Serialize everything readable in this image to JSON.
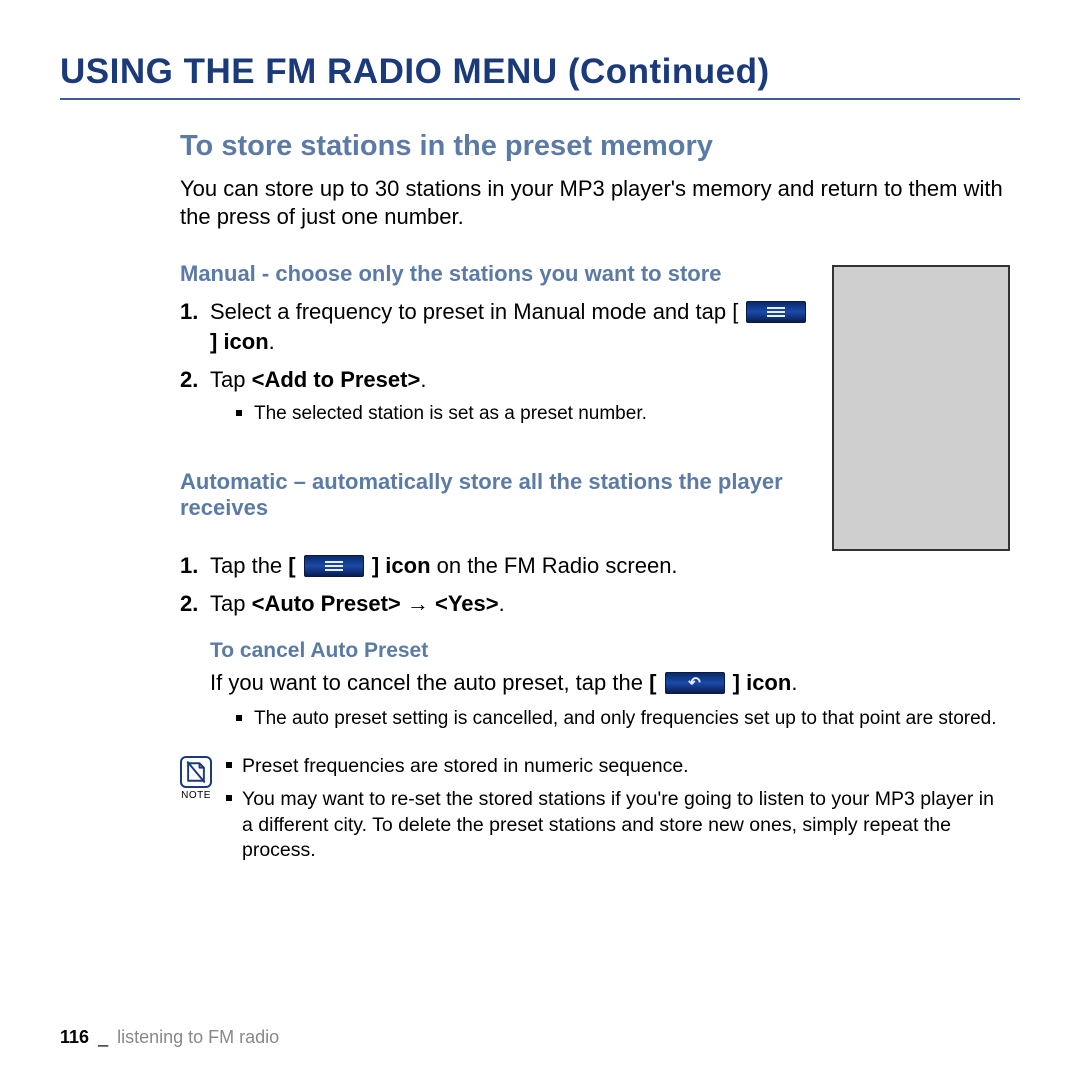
{
  "title": "USING THE FM RADIO MENU (Continued)",
  "section": {
    "heading": "To store stations in the preset memory",
    "intro": "You can store up to 30 stations in your MP3 player's memory and return to them with the press of just one number."
  },
  "manual": {
    "heading": "Manual - choose only the stations you want to store",
    "step1_a": "Select a frequency to preset in Manual mode and tap [",
    "step1_b": "] icon",
    "step1_c": ".",
    "step2_a": "Tap ",
    "step2_b": "<Add to Preset>",
    "step2_c": ".",
    "bullet1": "The selected station is set as a preset number."
  },
  "auto": {
    "heading": "Automatic – automatically store all the stations the player receives",
    "step1_a": "Tap the ",
    "step1_b": "[",
    "step1_c": "] icon",
    "step1_d": " on the FM Radio screen.",
    "step2_a": "Tap ",
    "step2_b": "<Auto Preset> → <Yes>",
    "step2_c": "."
  },
  "cancel": {
    "heading": "To cancel Auto Preset",
    "line_a": "If you want to cancel the auto preset, tap the ",
    "line_b": "[",
    "line_c": "] icon",
    "line_d": ".",
    "bullet1": "The auto preset setting is cancelled, and only frequencies set up to that point are stored."
  },
  "note": {
    "label": "NOTE",
    "item1": "Preset frequencies are stored in numeric sequence.",
    "item2": "You may want to re-set the stored stations if you're going to listen to your MP3 player in a different city. To delete the preset stations and store new ones, simply repeat the process."
  },
  "footer": {
    "page": "116",
    "sep": "_",
    "section": "listening to FM radio"
  }
}
